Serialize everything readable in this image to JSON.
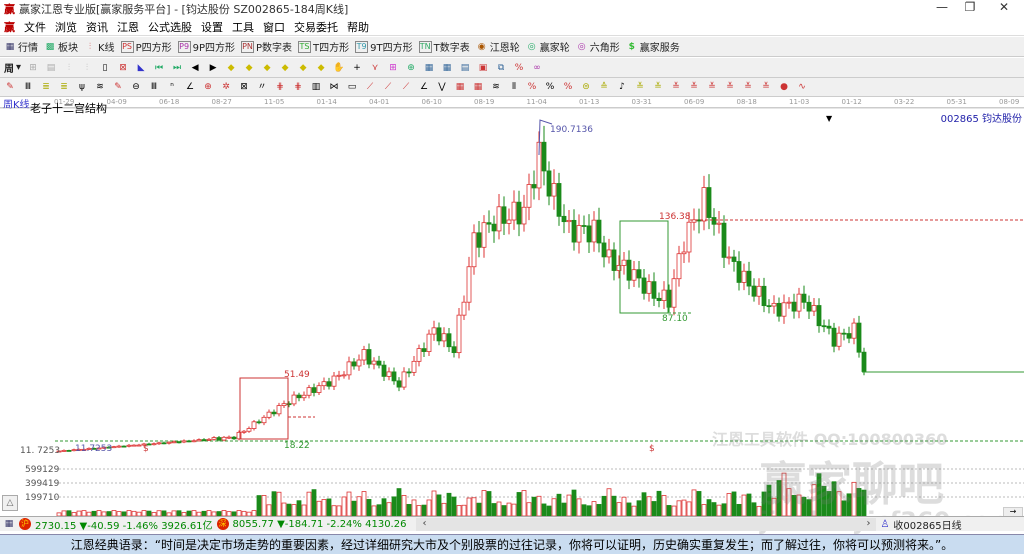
{
  "window": {
    "title": "赢家江恩专业版[赢家服务平台] - [钧达股份  SZ002865-184周K线]",
    "controls": [
      "—",
      "❐",
      "✕"
    ]
  },
  "menu": [
    "文件",
    "浏览",
    "资讯",
    "江恩",
    "公式选股",
    "设置",
    "工具",
    "窗口",
    "交易委托",
    "帮助"
  ],
  "toolbar1": [
    {
      "icon": "grid-icon",
      "label": "行情"
    },
    {
      "icon": "blocks-icon",
      "label": "板块"
    },
    {
      "icon": "kline-icon",
      "label": "K线"
    },
    {
      "icon": "p-square-icon",
      "tag": "PS",
      "label": "P四方形"
    },
    {
      "icon": "9p-square-icon",
      "tag": "P9",
      "label": "9P四方形"
    },
    {
      "icon": "p-table-icon",
      "tag": "PN",
      "label": "P数字表"
    },
    {
      "icon": "t-square-icon",
      "tag": "TS",
      "label": "T四方形"
    },
    {
      "icon": "9t-square-icon",
      "tag": "T9",
      "label": "9T四方形"
    },
    {
      "icon": "t-table-icon",
      "tag": "TN",
      "label": "T数字表"
    },
    {
      "icon": "gann-wheel-icon",
      "label": "江恩轮"
    },
    {
      "icon": "winner-wheel-icon",
      "label": "赢家轮"
    },
    {
      "icon": "hexagon-icon",
      "label": "六角形"
    },
    {
      "icon": "dollar-icon",
      "label": "赢家服务"
    }
  ],
  "toolbar2": {
    "period": "周"
  },
  "date_axis": [
    "01-29",
    "04-09",
    "06-18",
    "08-27",
    "11-05",
    "01-14",
    "04-01",
    "06-10",
    "08-19",
    "11-04",
    "01-13",
    "03-31",
    "06-09",
    "08-18",
    "11-03",
    "01-12",
    "03-22",
    "05-31",
    "08-09"
  ],
  "chart": {
    "period_label": "周K线",
    "indicator": "老子十二宫结构",
    "stock": "002865  钧达股份",
    "annotations": {
      "high": "190.7136",
      "low_start": "11.7253",
      "axis_low": "11. 7253",
      "p1": "51.49",
      "p2": "18.22",
      "p3": "136.38",
      "p4": "87.10",
      "dollar1": "$",
      "dollar2": "$"
    },
    "volume_ticks": [
      "599129",
      "399419",
      "199710"
    ],
    "watermark1": "江恩工具软件  QQ:100800360",
    "watermark2": "赢家聊吧",
    "watermark3": "jiaoba.yicf360.com"
  },
  "chart_data": {
    "type": "candlestick",
    "ylim": [
      11.72,
      190.71
    ],
    "close_keypoints": [
      [
        0,
        11.7
      ],
      [
        35,
        20
      ],
      [
        46,
        42
      ],
      [
        55,
        55
      ],
      [
        61,
        70
      ],
      [
        68,
        52
      ],
      [
        75,
        85
      ],
      [
        79,
        73
      ],
      [
        83,
        139
      ],
      [
        87,
        151
      ],
      [
        93,
        157
      ],
      [
        96,
        191
      ],
      [
        98,
        172
      ],
      [
        102,
        145
      ],
      [
        107,
        145
      ],
      [
        110,
        127
      ],
      [
        114,
        121
      ],
      [
        119,
        106
      ],
      [
        122,
        103
      ],
      [
        125,
        139
      ],
      [
        129,
        163
      ],
      [
        131,
        151
      ],
      [
        134,
        127
      ],
      [
        138,
        112
      ],
      [
        143,
        97
      ],
      [
        149,
        103
      ],
      [
        155,
        79
      ],
      [
        159,
        85
      ],
      [
        161,
        61
      ]
    ]
  },
  "status": {
    "sh": "2730.15 ▼-40.59 -1.46% 3926.61亿",
    "sz": "8055.77 ▼-184.71 -2.24% 4130.26",
    "right": "收002865日线"
  },
  "quote": "江恩经典语录：“时间是决定市场走势的重要因素，经过详细研究大市及个别股票的过往记录，你将可以证明，历史确实重复发生；而了解过往，你将可以预测将来。”。"
}
